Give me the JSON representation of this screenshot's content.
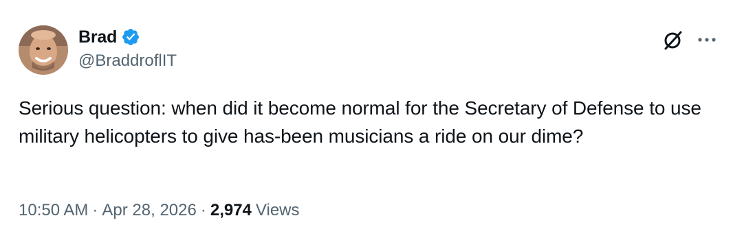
{
  "author": {
    "display_name": "Brad",
    "handle": "@BraddroflIT",
    "verified": true,
    "verified_color": "#1d9bf0"
  },
  "header_icons": {
    "grok": "grok-icon",
    "more": "more-icon"
  },
  "tweet": {
    "text": "Serious question: when did it become normal for the Secretary of Defense to use military helicopters to give has-been musicians a ride on our dime?",
    "time": "10:50 AM",
    "separator": "·",
    "date": "Apr 28, 2026",
    "views_count": "2,974",
    "views_label": "Views"
  },
  "colors": {
    "text_primary": "#0f1419",
    "text_secondary": "#536471",
    "accent": "#1d9bf0"
  }
}
